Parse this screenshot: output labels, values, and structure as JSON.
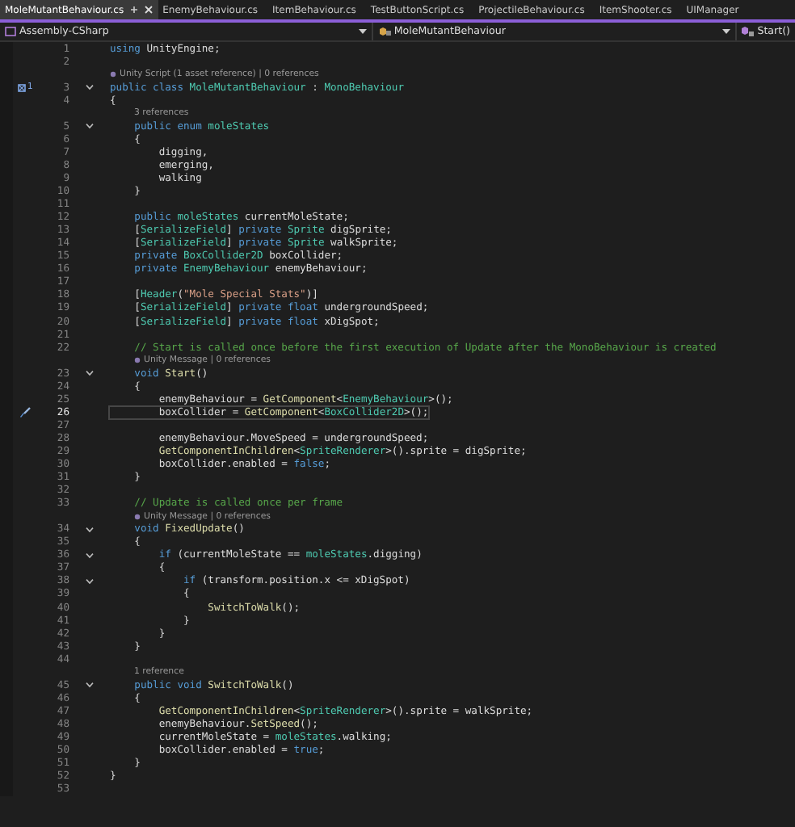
{
  "tabs": [
    {
      "label": "MoleMutantBehaviour.cs",
      "selected": true
    },
    {
      "label": "EnemyBehaviour.cs",
      "selected": false
    },
    {
      "label": "ItemBehaviour.cs",
      "selected": false
    },
    {
      "label": "TestButtonScript.cs",
      "selected": false
    },
    {
      "label": "ProjectileBehaviour.cs",
      "selected": false
    },
    {
      "label": "ItemShooter.cs",
      "selected": false
    },
    {
      "label": "UIManager",
      "selected": false
    }
  ],
  "navbar": {
    "project": "Assembly-CSharp",
    "type": "MoleMutantBehaviour",
    "member": "Start()"
  },
  "lines": [
    {
      "num": "1",
      "fold": false,
      "current": false,
      "tokens": [
        {
          "kind": "keyword",
          "text": "using"
        },
        {
          "kind": "plain",
          "text": " UnityEngine;"
        }
      ]
    },
    {
      "num": "2",
      "fold": false,
      "current": false
    },
    {
      "num": "3",
      "fold": true,
      "current": false,
      "badge": "1",
      "lens": {
        "text": "Unity Script (1 asset reference) | 0 references",
        "icon": true
      },
      "tokens": [
        {
          "kind": "keyword",
          "text": "public class "
        },
        {
          "kind": "type",
          "text": "MoleMutantBehaviour"
        },
        {
          "kind": "plain",
          "text": " : "
        },
        {
          "kind": "type",
          "text": "MonoBehaviour"
        }
      ]
    },
    {
      "num": "4",
      "fold": false,
      "current": false,
      "tokens": [
        {
          "kind": "plain",
          "text": "{"
        }
      ]
    },
    {
      "num": "5",
      "fold": true,
      "current": false,
      "lens": {
        "text": "3 references",
        "icon": false
      },
      "tokens": [
        {
          "kind": "keyword",
          "text": "    public enum "
        },
        {
          "kind": "type",
          "text": "moleStates"
        }
      ]
    },
    {
      "num": "6",
      "fold": false,
      "current": false,
      "tokens": [
        {
          "kind": "plain",
          "text": "    {"
        }
      ]
    },
    {
      "num": "7",
      "fold": false,
      "current": false,
      "tokens": [
        {
          "kind": "plain",
          "text": "        digging,"
        }
      ]
    },
    {
      "num": "8",
      "fold": false,
      "current": false,
      "tokens": [
        {
          "kind": "plain",
          "text": "        emerging,"
        }
      ]
    },
    {
      "num": "9",
      "fold": false,
      "current": false,
      "tokens": [
        {
          "kind": "plain",
          "text": "        walking"
        }
      ]
    },
    {
      "num": "10",
      "fold": false,
      "current": false,
      "tokens": [
        {
          "kind": "plain",
          "text": "    }"
        }
      ]
    },
    {
      "num": "11",
      "fold": false,
      "current": false
    },
    {
      "num": "12",
      "fold": false,
      "current": false,
      "tokens": [
        {
          "kind": "keyword",
          "text": "    public "
        },
        {
          "kind": "type",
          "text": "moleStates"
        },
        {
          "kind": "plain",
          "text": " currentMoleState;"
        }
      ]
    },
    {
      "num": "13",
      "fold": false,
      "current": false,
      "tokens": [
        {
          "kind": "plain",
          "text": "    ["
        },
        {
          "kind": "type",
          "text": "SerializeField"
        },
        {
          "kind": "plain",
          "text": "] "
        },
        {
          "kind": "keyword",
          "text": "private "
        },
        {
          "kind": "type",
          "text": "Sprite"
        },
        {
          "kind": "plain",
          "text": " digSprite;"
        }
      ]
    },
    {
      "num": "14",
      "fold": false,
      "current": false,
      "tokens": [
        {
          "kind": "plain",
          "text": "    ["
        },
        {
          "kind": "type",
          "text": "SerializeField"
        },
        {
          "kind": "plain",
          "text": "] "
        },
        {
          "kind": "keyword",
          "text": "private "
        },
        {
          "kind": "type",
          "text": "Sprite"
        },
        {
          "kind": "plain",
          "text": " walkSprite;"
        }
      ]
    },
    {
      "num": "15",
      "fold": false,
      "current": false,
      "tokens": [
        {
          "kind": "keyword",
          "text": "    private "
        },
        {
          "kind": "type",
          "text": "BoxCollider2D"
        },
        {
          "kind": "plain",
          "text": " boxCollider;"
        }
      ]
    },
    {
      "num": "16",
      "fold": false,
      "current": false,
      "tokens": [
        {
          "kind": "keyword",
          "text": "    private "
        },
        {
          "kind": "type",
          "text": "EnemyBehaviour"
        },
        {
          "kind": "plain",
          "text": " enemyBehaviour;"
        }
      ]
    },
    {
      "num": "17",
      "fold": false,
      "current": false
    },
    {
      "num": "18",
      "fold": false,
      "current": false,
      "tokens": [
        {
          "kind": "plain",
          "text": "    ["
        },
        {
          "kind": "type",
          "text": "Header"
        },
        {
          "kind": "plain",
          "text": "("
        },
        {
          "kind": "string",
          "text": "\"Mole Special Stats\""
        },
        {
          "kind": "plain",
          "text": ")]"
        }
      ]
    },
    {
      "num": "19",
      "fold": false,
      "current": false,
      "tokens": [
        {
          "kind": "plain",
          "text": "    ["
        },
        {
          "kind": "type",
          "text": "SerializeField"
        },
        {
          "kind": "plain",
          "text": "] "
        },
        {
          "kind": "keyword",
          "text": "private float "
        },
        {
          "kind": "plain",
          "text": "undergroundSpeed;"
        }
      ]
    },
    {
      "num": "20",
      "fold": false,
      "current": false,
      "tokens": [
        {
          "kind": "plain",
          "text": "    ["
        },
        {
          "kind": "type",
          "text": "SerializeField"
        },
        {
          "kind": "plain",
          "text": "] "
        },
        {
          "kind": "keyword",
          "text": "private float "
        },
        {
          "kind": "plain",
          "text": "xDigSpot;"
        }
      ]
    },
    {
      "num": "21",
      "fold": false,
      "current": false
    },
    {
      "num": "22",
      "fold": false,
      "current": false,
      "tokens": [
        {
          "kind": "comment",
          "text": "    // Start is called once before the first execution of Update after the MonoBehaviour is created"
        }
      ]
    },
    {
      "num": "23",
      "fold": true,
      "current": false,
      "lens": {
        "text": "Unity Message | 0 references",
        "icon": true
      },
      "tokens": [
        {
          "kind": "keyword",
          "text": "    void "
        },
        {
          "kind": "method",
          "text": "Start"
        },
        {
          "kind": "plain",
          "text": "()"
        }
      ]
    },
    {
      "num": "24",
      "fold": false,
      "current": false,
      "tokens": [
        {
          "kind": "plain",
          "text": "    {"
        }
      ]
    },
    {
      "num": "25",
      "fold": false,
      "current": false,
      "tokens": [
        {
          "kind": "plain",
          "text": "        enemyBehaviour = "
        },
        {
          "kind": "method",
          "text": "GetComponent"
        },
        {
          "kind": "plain",
          "text": "<"
        },
        {
          "kind": "type",
          "text": "EnemyBehaviour"
        },
        {
          "kind": "plain",
          "text": ">();"
        }
      ]
    },
    {
      "num": "26",
      "fold": false,
      "current": true,
      "marker": {
        "kind": "brush"
      },
      "tokens": [
        {
          "kind": "plain",
          "text": "        boxCollider = "
        },
        {
          "kind": "method",
          "text": "GetComponent"
        },
        {
          "kind": "plain",
          "text": "<"
        },
        {
          "kind": "type",
          "text": "BoxCollider2D"
        },
        {
          "kind": "plain",
          "text": ">();"
        }
      ]
    },
    {
      "num": "27",
      "fold": false,
      "current": false
    },
    {
      "num": "28",
      "fold": false,
      "current": false,
      "tokens": [
        {
          "kind": "plain",
          "text": "        enemyBehaviour.MoveSpeed = undergroundSpeed;"
        }
      ]
    },
    {
      "num": "29",
      "fold": false,
      "current": false,
      "tokens": [
        {
          "kind": "method",
          "text": "        GetComponentInChildren"
        },
        {
          "kind": "plain",
          "text": "<"
        },
        {
          "kind": "type",
          "text": "SpriteRenderer"
        },
        {
          "kind": "plain",
          "text": ">().sprite = digSprite;"
        }
      ]
    },
    {
      "num": "30",
      "fold": false,
      "current": false,
      "tokens": [
        {
          "kind": "plain",
          "text": "        boxCollider.enabled = "
        },
        {
          "kind": "keyword",
          "text": "false"
        },
        {
          "kind": "plain",
          "text": ";"
        }
      ]
    },
    {
      "num": "31",
      "fold": false,
      "current": false,
      "tokens": [
        {
          "kind": "plain",
          "text": "    }"
        }
      ]
    },
    {
      "num": "32",
      "fold": false,
      "current": false
    },
    {
      "num": "33",
      "fold": false,
      "current": false,
      "tokens": [
        {
          "kind": "comment",
          "text": "    // Update is called once per frame"
        }
      ]
    },
    {
      "num": "34",
      "fold": true,
      "current": false,
      "lens": {
        "text": "Unity Message | 0 references",
        "icon": true
      },
      "tokens": [
        {
          "kind": "keyword",
          "text": "    void "
        },
        {
          "kind": "method",
          "text": "FixedUpdate"
        },
        {
          "kind": "plain",
          "text": "()"
        }
      ]
    },
    {
      "num": "35",
      "fold": false,
      "current": false,
      "tokens": [
        {
          "kind": "plain",
          "text": "    {"
        }
      ]
    },
    {
      "num": "36",
      "fold": true,
      "current": false,
      "tokens": [
        {
          "kind": "keyword",
          "text": "        if"
        },
        {
          "kind": "plain",
          "text": " (currentMoleState == "
        },
        {
          "kind": "type",
          "text": "moleStates"
        },
        {
          "kind": "plain",
          "text": ".digging)"
        }
      ]
    },
    {
      "num": "37",
      "fold": false,
      "current": false,
      "tokens": [
        {
          "kind": "plain",
          "text": "        {"
        }
      ]
    },
    {
      "num": "38",
      "fold": true,
      "current": false,
      "tokens": [
        {
          "kind": "keyword",
          "text": "            if"
        },
        {
          "kind": "plain",
          "text": " (transform.position.x <= xDigSpot)"
        }
      ]
    },
    {
      "num": "39",
      "fold": false,
      "current": false,
      "tokens": [
        {
          "kind": "plain",
          "text": "            {"
        }
      ]
    },
    {
      "num": "40",
      "fold": false,
      "current": false,
      "tokens": [
        {
          "kind": "method",
          "text": "                SwitchToWalk"
        },
        {
          "kind": "plain",
          "text": "();"
        }
      ]
    },
    {
      "num": "41",
      "fold": false,
      "current": false,
      "tokens": [
        {
          "kind": "plain",
          "text": "            }"
        }
      ]
    },
    {
      "num": "42",
      "fold": false,
      "current": false,
      "tokens": [
        {
          "kind": "plain",
          "text": "        }"
        }
      ]
    },
    {
      "num": "43",
      "fold": false,
      "current": false,
      "tokens": [
        {
          "kind": "plain",
          "text": "    }"
        }
      ]
    },
    {
      "num": "44",
      "fold": false,
      "current": false
    },
    {
      "num": "45",
      "fold": true,
      "current": false,
      "lens": {
        "text": "1 reference",
        "icon": false
      },
      "tokens": [
        {
          "kind": "keyword",
          "text": "    public void "
        },
        {
          "kind": "method",
          "text": "SwitchToWalk"
        },
        {
          "kind": "plain",
          "text": "()"
        }
      ]
    },
    {
      "num": "46",
      "fold": false,
      "current": false,
      "tokens": [
        {
          "kind": "plain",
          "text": "    {"
        }
      ]
    },
    {
      "num": "47",
      "fold": false,
      "current": false,
      "tokens": [
        {
          "kind": "method",
          "text": "        GetComponentInChildren"
        },
        {
          "kind": "plain",
          "text": "<"
        },
        {
          "kind": "type",
          "text": "SpriteRenderer"
        },
        {
          "kind": "plain",
          "text": ">().sprite = walkSprite;"
        }
      ]
    },
    {
      "num": "48",
      "fold": false,
      "current": false,
      "tokens": [
        {
          "kind": "plain",
          "text": "        enemyBehaviour."
        },
        {
          "kind": "method",
          "text": "SetSpeed"
        },
        {
          "kind": "plain",
          "text": "();"
        }
      ]
    },
    {
      "num": "49",
      "fold": false,
      "current": false,
      "tokens": [
        {
          "kind": "plain",
          "text": "        currentMoleState = "
        },
        {
          "kind": "type",
          "text": "moleStates"
        },
        {
          "kind": "plain",
          "text": ".walking;"
        }
      ]
    },
    {
      "num": "50",
      "fold": false,
      "current": false,
      "tokens": [
        {
          "kind": "plain",
          "text": "        boxCollider.enabled = "
        },
        {
          "kind": "keyword",
          "text": "true"
        },
        {
          "kind": "plain",
          "text": ";"
        }
      ]
    },
    {
      "num": "51",
      "fold": false,
      "current": false,
      "tokens": [
        {
          "kind": "plain",
          "text": "    }"
        }
      ]
    },
    {
      "num": "52",
      "fold": false,
      "current": false,
      "tokens": [
        {
          "kind": "plain",
          "text": "}"
        }
      ]
    },
    {
      "num": "53",
      "fold": false,
      "current": false
    }
  ]
}
